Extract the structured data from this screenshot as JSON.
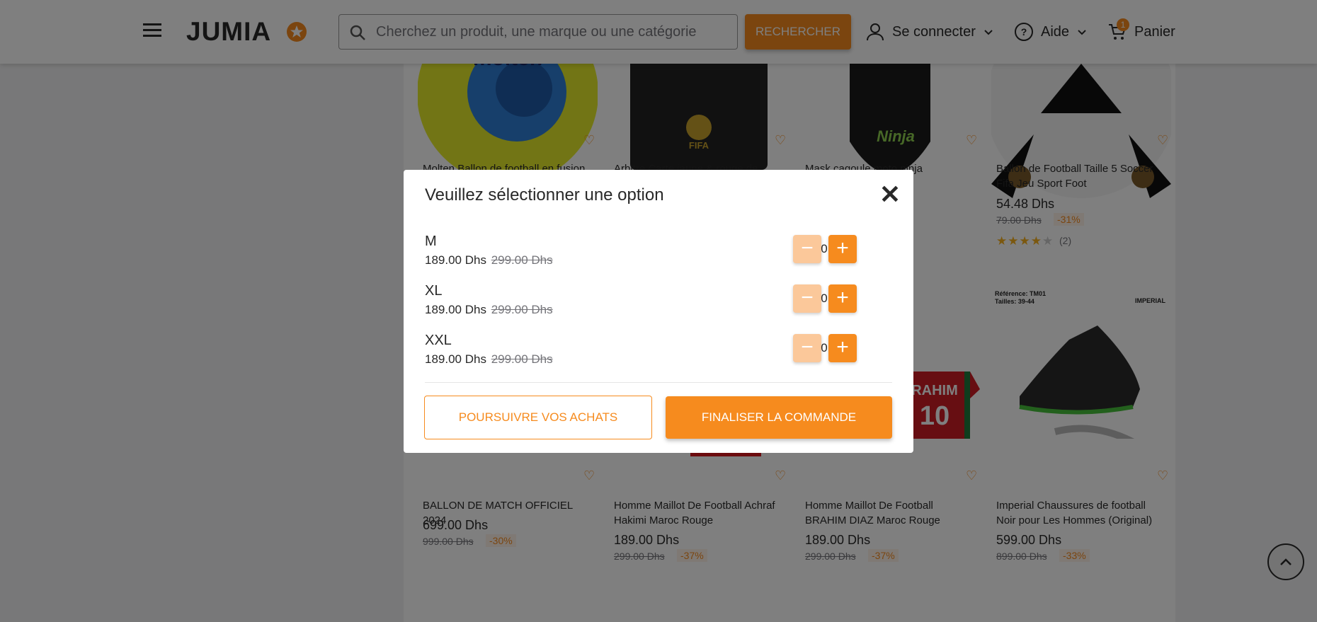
{
  "header": {
    "logo": "JUMIA",
    "search_placeholder": "Cherchez un produit, une marque ou une catégorie",
    "search_button": "RECHERCHER",
    "login": "Se connecter",
    "help": "Aide",
    "cart": "Panier",
    "cart_count": "1"
  },
  "products_top": [
    {
      "title": "Molten Ballon de football en fusion",
      "price": "",
      "old_price": "",
      "discount": ""
    },
    {
      "title": "Arbitre Carte jaune & rouge de",
      "price": "",
      "old_price": "",
      "discount": ""
    },
    {
      "title": "Mask cagoule moto ninja",
      "price": "",
      "old_price": "",
      "discount": ""
    },
    {
      "title": "Ballon de Football Taille 5 Soccer Fifa Jeu Sport Foot",
      "price": "54.48 Dhs",
      "old_price": "79.00 Dhs",
      "discount": "-31%",
      "rating_count": "(2)",
      "rating": 3.5
    }
  ],
  "products_bottom": [
    {
      "title": "BALLON DE MATCH OFFICIEL 2024",
      "price": "699.00 Dhs",
      "old_price": "999.00 Dhs",
      "discount": "-30%"
    },
    {
      "title": "Homme Maillot De Football Achraf Hakimi Maroc Rouge",
      "price": "189.00 Dhs",
      "old_price": "299.00 Dhs",
      "discount": "-37%"
    },
    {
      "title": "Homme Maillot De Football BRAHIM DIAZ Maroc Rouge",
      "price": "189.00 Dhs",
      "old_price": "299.00 Dhs",
      "discount": "-37%"
    },
    {
      "title": "Imperial Chaussures de football Noir pour Les Hommes (Original)",
      "price": "599.00 Dhs",
      "old_price": "899.00 Dhs",
      "discount": "-33%"
    }
  ],
  "image_text": {
    "molten": "molten",
    "fifa": "FIFA",
    "ninja": "Ninja",
    "ref": "Référence: TM01",
    "sizes": "Tailles: 39-44",
    "imperial": "IMPERIAL",
    "jersey_name": "RAHIM",
    "jersey_num": "10"
  },
  "modal": {
    "title": "Veuillez sélectionner une option",
    "options": [
      {
        "size": "M",
        "price": "189.00 Dhs",
        "old_price": "299.00 Dhs",
        "qty": "0"
      },
      {
        "size": "XL",
        "price": "189.00 Dhs",
        "old_price": "299.00 Dhs",
        "qty": "0"
      },
      {
        "size": "XXL",
        "price": "189.00 Dhs",
        "old_price": "299.00 Dhs",
        "qty": "0"
      }
    ],
    "continue_button": "POURSUIVRE VOS ACHATS",
    "checkout_button": "FINALISER LA COMMANDE"
  },
  "colors": {
    "accent": "#f68b1e",
    "text": "#282828",
    "muted": "#75757a"
  }
}
